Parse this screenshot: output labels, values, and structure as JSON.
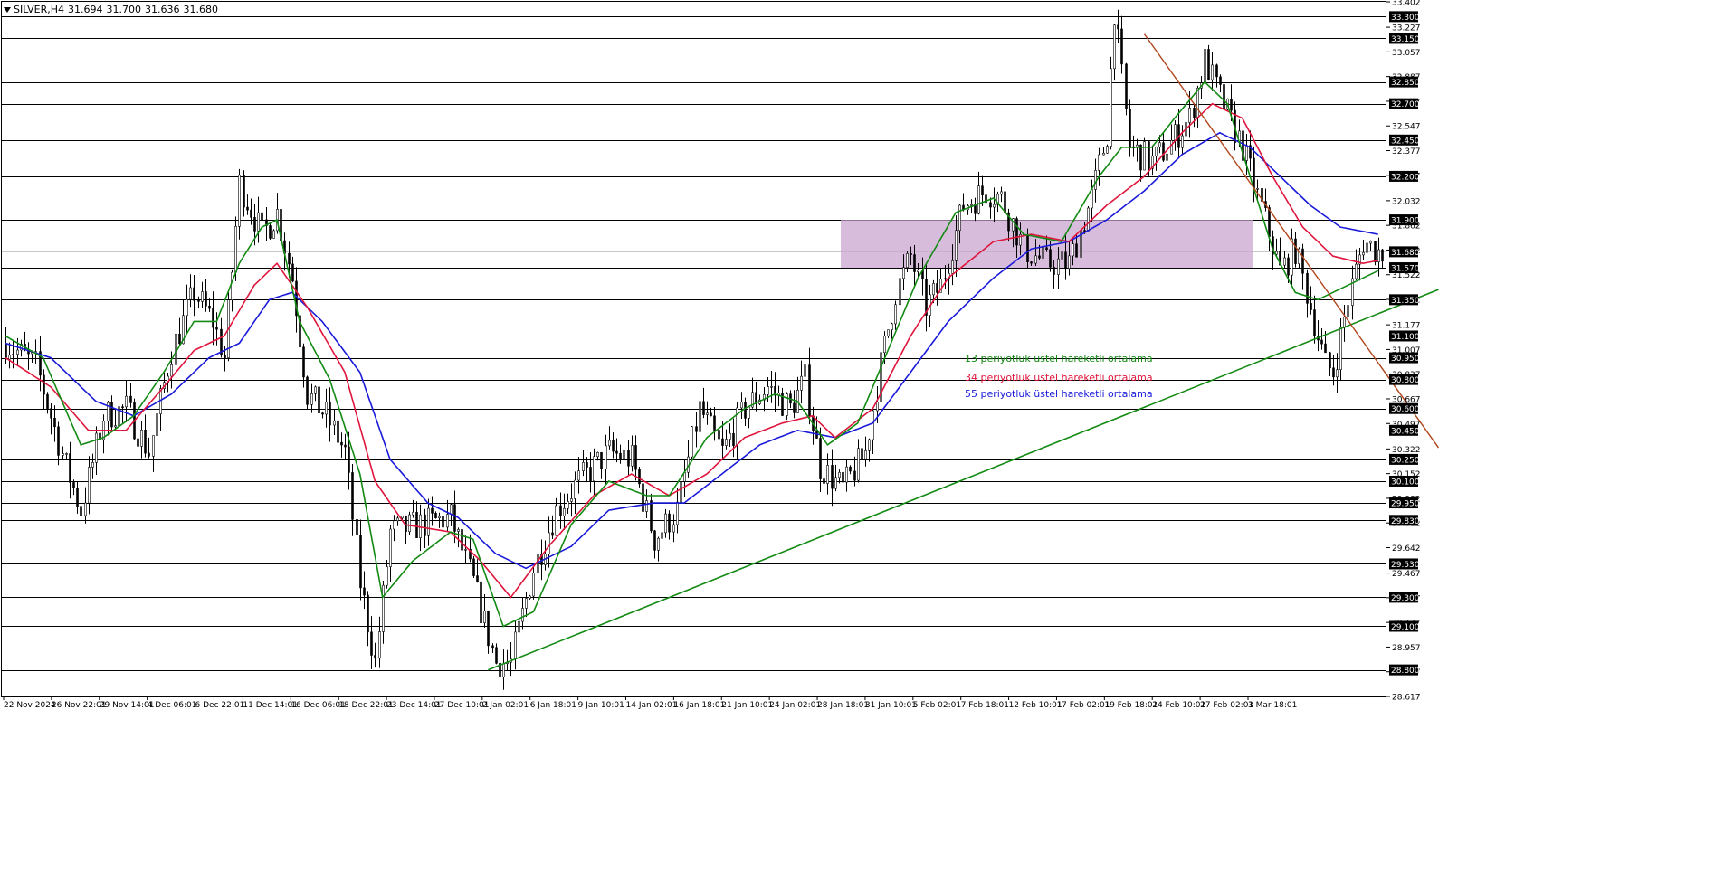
{
  "header": {
    "symbol": "SILVER,H4",
    "open": "31.694",
    "high": "31.700",
    "low": "31.636",
    "close": "31.680"
  },
  "legend": {
    "ema13": "13 periyotluk üstel hareketli ortalama",
    "ema34": "34 periyotluk üstel hareketli ortalama",
    "ema55": "55 periyotluk üstel hareketli ortalama"
  },
  "colors": {
    "ema13": "#138a13",
    "ema34": "#e0153c",
    "ema55": "#1a1adb",
    "trendline_up": "#138a13",
    "trendline_down": "#b0461c",
    "zone": "#c9a5cf",
    "candle": "#000000",
    "level_badge": "#000000"
  },
  "chart_data": {
    "type": "candlestick",
    "timeframe": "H4",
    "y_range": [
      28.617,
      33.402
    ],
    "y_ticks": [
      "33.402",
      "33.227",
      "33.057",
      "32.887",
      "32.717",
      "32.547",
      "32.377",
      "32.207",
      "32.032",
      "31.862",
      "31.692",
      "31.522",
      "31.352",
      "31.177",
      "31.007",
      "30.837",
      "30.667",
      "30.497",
      "30.322",
      "30.152",
      "29.982",
      "29.812",
      "29.642",
      "29.467",
      "29.297",
      "29.127",
      "28.957",
      "28.787",
      "28.617"
    ],
    "x_labels": [
      "22 Nov 2024",
      "26 Nov 22:01",
      "29 Nov 14:01",
      "4 Dec 06:01",
      "6 Dec 22:01",
      "11 Dec 14:01",
      "16 Dec 06:01",
      "18 Dec 22:01",
      "23 Dec 14:01",
      "27 Dec 10:01",
      "2 Jan 02:01",
      "6 Jan 18:01",
      "9 Jan 10:01",
      "14 Jan 02:01",
      "16 Jan 18:01",
      "21 Jan 10:01",
      "24 Jan 02:01",
      "28 Jan 18:01",
      "31 Jan 10:01",
      "5 Feb 02:01",
      "7 Feb 18:01",
      "12 Feb 10:01",
      "17 Feb 02:01",
      "19 Feb 18:01",
      "24 Feb 10:01",
      "27 Feb 02:01",
      "3 Mar 18:01"
    ],
    "levels": [
      "33.300",
      "33.150",
      "32.850",
      "32.700",
      "32.450",
      "32.200",
      "31.900",
      "31.570",
      "31.350",
      "31.100",
      "30.950",
      "30.800",
      "30.600",
      "30.450",
      "30.250",
      "30.100",
      "29.950",
      "29.830",
      "29.530",
      "29.300",
      "29.100",
      "28.800"
    ],
    "current_price": "31.680",
    "zone": {
      "from": 31.57,
      "to": 31.9
    },
    "path_anchors": [
      [
        0,
        31.05
      ],
      [
        8,
        30.9
      ],
      [
        16,
        30.2
      ],
      [
        20,
        29.9
      ],
      [
        26,
        30.55
      ],
      [
        32,
        30.6
      ],
      [
        38,
        30.3
      ],
      [
        44,
        31.0
      ],
      [
        50,
        31.4
      ],
      [
        55,
        31.2
      ],
      [
        58,
        30.95
      ],
      [
        62,
        32.15
      ],
      [
        68,
        31.8
      ],
      [
        72,
        31.95
      ],
      [
        76,
        31.5
      ],
      [
        80,
        30.7
      ],
      [
        85,
        30.55
      ],
      [
        90,
        30.3
      ],
      [
        94,
        29.4
      ],
      [
        98,
        28.85
      ],
      [
        102,
        29.75
      ],
      [
        110,
        29.8
      ],
      [
        118,
        29.85
      ],
      [
        124,
        29.4
      ],
      [
        130,
        28.85
      ],
      [
        134,
        28.85
      ],
      [
        140,
        29.5
      ],
      [
        146,
        29.9
      ],
      [
        152,
        30.1
      ],
      [
        160,
        30.3
      ],
      [
        166,
        30.25
      ],
      [
        172,
        29.7
      ],
      [
        178,
        29.9
      ],
      [
        184,
        30.6
      ],
      [
        190,
        30.3
      ],
      [
        196,
        30.6
      ],
      [
        202,
        30.75
      ],
      [
        208,
        30.6
      ],
      [
        212,
        30.8
      ],
      [
        216,
        30.2
      ],
      [
        222,
        30.05
      ],
      [
        228,
        30.3
      ],
      [
        232,
        30.9
      ],
      [
        236,
        31.4
      ],
      [
        240,
        31.65
      ],
      [
        244,
        31.3
      ],
      [
        248,
        31.45
      ],
      [
        254,
        32.0
      ],
      [
        260,
        32.1
      ],
      [
        264,
        32.05
      ],
      [
        270,
        31.7
      ],
      [
        276,
        31.6
      ],
      [
        282,
        31.6
      ],
      [
        288,
        32.05
      ],
      [
        292,
        32.5
      ],
      [
        294,
        33.35
      ],
      [
        298,
        32.4
      ],
      [
        304,
        32.3
      ],
      [
        308,
        32.4
      ],
      [
        314,
        32.6
      ],
      [
        318,
        33.0
      ],
      [
        322,
        32.75
      ],
      [
        328,
        32.4
      ],
      [
        334,
        31.9
      ],
      [
        338,
        31.55
      ],
      [
        342,
        31.7
      ],
      [
        346,
        31.3
      ],
      [
        350,
        30.9
      ],
      [
        352,
        30.85
      ],
      [
        356,
        31.35
      ],
      [
        360,
        31.75
      ],
      [
        364,
        31.68
      ]
    ],
    "ema_anchors": {
      "ema13": [
        [
          0,
          31.1
        ],
        [
          10,
          30.95
        ],
        [
          20,
          30.35
        ],
        [
          26,
          30.4
        ],
        [
          34,
          30.55
        ],
        [
          42,
          30.85
        ],
        [
          50,
          31.2
        ],
        [
          56,
          31.2
        ],
        [
          62,
          31.6
        ],
        [
          68,
          31.85
        ],
        [
          72,
          31.9
        ],
        [
          78,
          31.2
        ],
        [
          86,
          30.8
        ],
        [
          94,
          30.15
        ],
        [
          100,
          29.3
        ],
        [
          108,
          29.55
        ],
        [
          118,
          29.75
        ],
        [
          124,
          29.7
        ],
        [
          132,
          29.1
        ],
        [
          140,
          29.2
        ],
        [
          150,
          29.8
        ],
        [
          160,
          30.1
        ],
        [
          170,
          30.0
        ],
        [
          176,
          30.0
        ],
        [
          186,
          30.4
        ],
        [
          196,
          30.6
        ],
        [
          204,
          30.7
        ],
        [
          210,
          30.65
        ],
        [
          218,
          30.35
        ],
        [
          226,
          30.5
        ],
        [
          234,
          31.0
        ],
        [
          242,
          31.5
        ],
        [
          252,
          31.95
        ],
        [
          262,
          32.05
        ],
        [
          270,
          31.8
        ],
        [
          280,
          31.75
        ],
        [
          290,
          32.2
        ],
        [
          296,
          32.4
        ],
        [
          304,
          32.4
        ],
        [
          310,
          32.6
        ],
        [
          318,
          32.85
        ],
        [
          324,
          32.7
        ],
        [
          330,
          32.2
        ],
        [
          336,
          31.7
        ],
        [
          342,
          31.4
        ],
        [
          348,
          31.35
        ],
        [
          356,
          31.45
        ],
        [
          364,
          31.55
        ]
      ],
      "ema34": [
        [
          0,
          30.95
        ],
        [
          12,
          30.75
        ],
        [
          22,
          30.45
        ],
        [
          32,
          30.45
        ],
        [
          42,
          30.75
        ],
        [
          50,
          31.0
        ],
        [
          58,
          31.1
        ],
        [
          66,
          31.45
        ],
        [
          72,
          31.6
        ],
        [
          80,
          31.3
        ],
        [
          90,
          30.85
        ],
        [
          98,
          30.1
        ],
        [
          106,
          29.8
        ],
        [
          118,
          29.75
        ],
        [
          126,
          29.55
        ],
        [
          134,
          29.3
        ],
        [
          144,
          29.65
        ],
        [
          156,
          30.0
        ],
        [
          166,
          30.15
        ],
        [
          176,
          30.0
        ],
        [
          186,
          30.15
        ],
        [
          196,
          30.4
        ],
        [
          206,
          30.5
        ],
        [
          214,
          30.55
        ],
        [
          220,
          30.4
        ],
        [
          230,
          30.6
        ],
        [
          240,
          31.1
        ],
        [
          250,
          31.5
        ],
        [
          262,
          31.75
        ],
        [
          272,
          31.8
        ],
        [
          282,
          31.75
        ],
        [
          292,
          32.0
        ],
        [
          302,
          32.2
        ],
        [
          312,
          32.5
        ],
        [
          320,
          32.7
        ],
        [
          328,
          32.6
        ],
        [
          336,
          32.2
        ],
        [
          344,
          31.85
        ],
        [
          352,
          31.65
        ],
        [
          360,
          31.6
        ],
        [
          364,
          31.62
        ]
      ],
      "ema55": [
        [
          0,
          31.05
        ],
        [
          12,
          30.95
        ],
        [
          24,
          30.65
        ],
        [
          34,
          30.55
        ],
        [
          44,
          30.7
        ],
        [
          54,
          30.95
        ],
        [
          62,
          31.05
        ],
        [
          70,
          31.35
        ],
        [
          76,
          31.4
        ],
        [
          84,
          31.2
        ],
        [
          94,
          30.85
        ],
        [
          102,
          30.25
        ],
        [
          112,
          29.95
        ],
        [
          120,
          29.85
        ],
        [
          130,
          29.6
        ],
        [
          138,
          29.5
        ],
        [
          150,
          29.65
        ],
        [
          160,
          29.9
        ],
        [
          172,
          29.95
        ],
        [
          180,
          29.95
        ],
        [
          190,
          30.15
        ],
        [
          200,
          30.35
        ],
        [
          210,
          30.45
        ],
        [
          220,
          30.4
        ],
        [
          230,
          30.5
        ],
        [
          240,
          30.85
        ],
        [
          250,
          31.2
        ],
        [
          262,
          31.5
        ],
        [
          272,
          31.7
        ],
        [
          282,
          31.75
        ],
        [
          292,
          31.9
        ],
        [
          302,
          32.1
        ],
        [
          312,
          32.35
        ],
        [
          322,
          32.5
        ],
        [
          330,
          32.4
        ],
        [
          338,
          32.2
        ],
        [
          346,
          32.0
        ],
        [
          354,
          31.85
        ],
        [
          364,
          31.8
        ]
      ]
    },
    "trendlines": [
      {
        "from": [
          128,
          28.8
        ],
        "to": [
          380,
          31.42
        ]
      },
      {
        "from": [
          302,
          33.18
        ],
        "to": [
          380,
          30.33
        ]
      }
    ]
  }
}
